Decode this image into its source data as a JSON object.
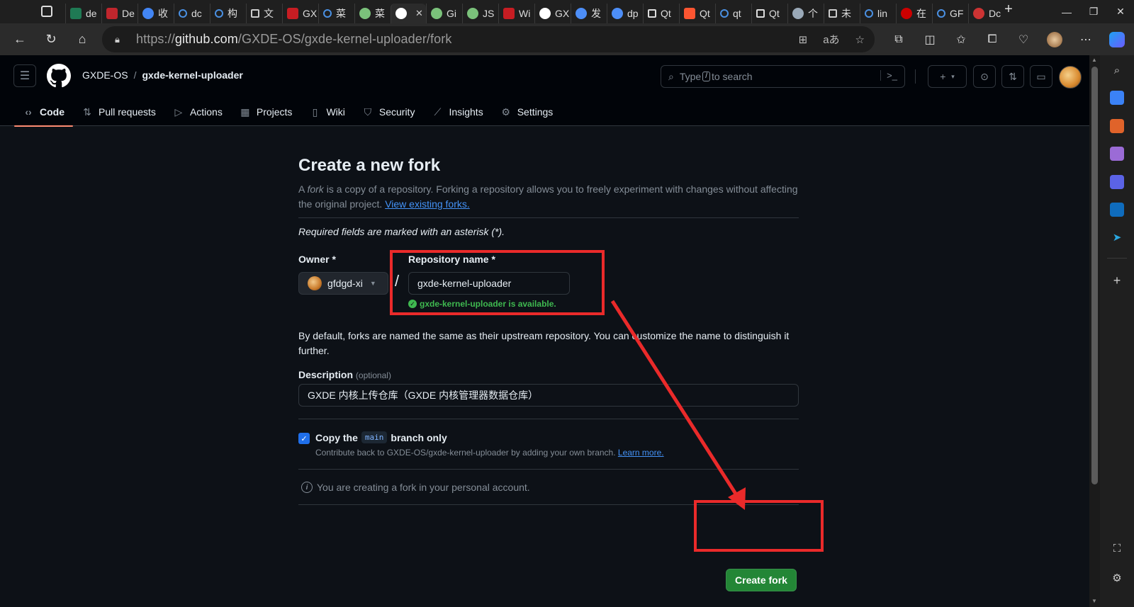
{
  "browser": {
    "tabs": [
      {
        "title": "de",
        "favicon": "sheets-icon",
        "color": "#1f7a54"
      },
      {
        "title": "De",
        "favicon": "video-icon",
        "color": "#c0262d"
      },
      {
        "title": "收",
        "favicon": "chrome-icon",
        "color": "#4285f4"
      },
      {
        "title": "dc",
        "favicon": "search-icon",
        "color": "#4a90e2"
      },
      {
        "title": "构",
        "favicon": "search-icon",
        "color": "#4a90e2"
      },
      {
        "title": "文",
        "favicon": "document-icon",
        "color": "#cccccc"
      },
      {
        "title": "GX",
        "favicon": "gitee-icon",
        "color": "#c71d23"
      },
      {
        "title": "菜",
        "favicon": "search-icon",
        "color": "#4a90e2"
      },
      {
        "title": "菜",
        "favicon": "robot-icon",
        "color": "#7bc27b"
      },
      {
        "title": "",
        "favicon": "github-icon",
        "color": "#ffffff",
        "active": true
      },
      {
        "title": "Gi",
        "favicon": "robot-icon",
        "color": "#7bc27b"
      },
      {
        "title": "JS",
        "favicon": "robot-icon",
        "color": "#7bc27b"
      },
      {
        "title": "Wi",
        "favicon": "gitee-icon",
        "color": "#c71d23"
      },
      {
        "title": "GX",
        "favicon": "github-icon",
        "color": "#ffffff"
      },
      {
        "title": "发",
        "favicon": "deepseek-icon",
        "color": "#4d8ef7"
      },
      {
        "title": "dp",
        "favicon": "deepseek-icon",
        "color": "#4d8ef7"
      },
      {
        "title": "Qt",
        "favicon": "ai-icon",
        "color": "#dddddd"
      },
      {
        "title": "Qt",
        "favicon": "csdn-icon",
        "color": "#fc5531"
      },
      {
        "title": "qt",
        "favicon": "search-icon",
        "color": "#4a90e2"
      },
      {
        "title": "Qt",
        "favicon": "ai-icon",
        "color": "#dddddd"
      },
      {
        "title": "个",
        "favicon": "openai-icon",
        "color": "#9aa9b8"
      },
      {
        "title": "未",
        "favicon": "document-icon",
        "color": "#cccccc"
      },
      {
        "title": "lin",
        "favicon": "search-icon",
        "color": "#4a90e2"
      },
      {
        "title": "在",
        "favicon": "redhat-icon",
        "color": "#cc0000"
      },
      {
        "title": "GF",
        "favicon": "search-icon",
        "color": "#4a90e2"
      },
      {
        "title": "Dc",
        "favicon": "power-icon",
        "color": "#cc3333"
      }
    ],
    "url_prefix": "https://",
    "url_host": "github.com",
    "url_path": "/GXDE-OS/gxde-kernel-uploader/fork"
  },
  "header": {
    "owner": "GXDE-OS",
    "separator": "/",
    "repo": "gxde-kernel-uploader",
    "search_before": "Type",
    "search_key": "/",
    "search_after": "to search"
  },
  "repo_nav": [
    {
      "label": "Code",
      "icon": "code-icon",
      "glyph": "‹›",
      "selected": true
    },
    {
      "label": "Pull requests",
      "icon": "pull-request-icon",
      "glyph": "⇅"
    },
    {
      "label": "Actions",
      "icon": "play-icon",
      "glyph": "▷"
    },
    {
      "label": "Projects",
      "icon": "table-icon",
      "glyph": "▦"
    },
    {
      "label": "Wiki",
      "icon": "book-icon",
      "glyph": "▯"
    },
    {
      "label": "Security",
      "icon": "shield-icon",
      "glyph": "⛉"
    },
    {
      "label": "Insights",
      "icon": "graph-icon",
      "glyph": "⟋"
    },
    {
      "label": "Settings",
      "icon": "gear-icon",
      "glyph": "⚙"
    }
  ],
  "form": {
    "title": "Create a new fork",
    "subtitle_1": "A ",
    "subtitle_fork": "fork",
    "subtitle_2": " is a copy of a repository. Forking a repository allows you to freely experiment with changes without affecting the original project. ",
    "view_forks_link": "View existing forks.",
    "required_note": "Required fields are marked with an asterisk (*).",
    "owner_label": "Owner *",
    "owner_value": "gfdgd-xi",
    "slash": "/",
    "repo_name_label": "Repository name *",
    "repo_name_value": "gxde-kernel-uploader",
    "availability": "gxde-kernel-uploader is available.",
    "default_note": "By default, forks are named the same as their upstream repository. You can customize the name to distinguish it further.",
    "description_label": "Description",
    "description_optional": "(optional)",
    "description_value": "GXDE 内核上传仓库（GXDE 内核管理器数据仓库）",
    "copy_branch_before": "Copy the",
    "copy_branch_code": "main",
    "copy_branch_after": "branch only",
    "copy_branch_checked": true,
    "copy_hint": "Contribute back to GXDE-OS/gxde-kernel-uploader by adding your own branch.",
    "learn_more": "Learn more.",
    "personal_note": "You are creating a fork in your personal account.",
    "create_button": "Create fork"
  },
  "colors": {
    "accent_green": "#238636",
    "link_blue": "#4493f8",
    "available_green": "#3fb950",
    "annotation_red": "#ea2a2a",
    "selected_tab_underline": "#fd8c73"
  }
}
